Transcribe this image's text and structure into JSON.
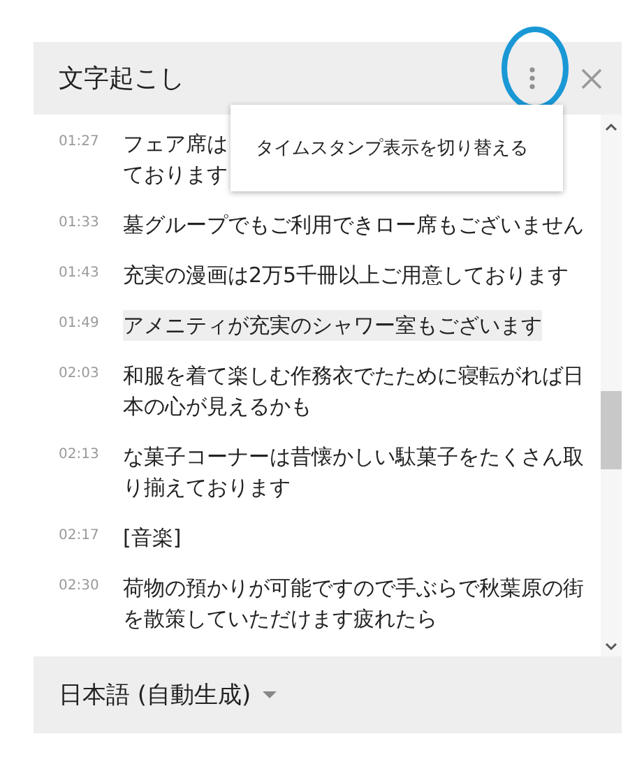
{
  "panel": {
    "title": "文字起こし"
  },
  "menu": {
    "items": [
      "タイムスタンプ表示を切り替える"
    ]
  },
  "transcript": [
    {
      "time": "01:27",
      "text": "フェア席は",
      "text_2": "ております",
      "current": false
    },
    {
      "time": "01:33",
      "text": "墓グループでもご利用できロー席もございません",
      "current": false
    },
    {
      "time": "01:43",
      "text": "充実の漫画は2万5千冊以上ご用意しております",
      "current": false
    },
    {
      "time": "01:49",
      "text": "アメニティが充実のシャワー室もございます",
      "current": true
    },
    {
      "time": "02:03",
      "text": "和服を着て楽しむ作務衣でたために寝転がれば日本の心が見えるかも",
      "current": false
    },
    {
      "time": "02:13",
      "text": "な菓子コーナーは昔懐かしい駄菓子をたくさん取り揃えております",
      "current": false
    },
    {
      "time": "02:17",
      "text": "[音楽]",
      "current": false
    },
    {
      "time": "02:30",
      "text": "荷物の預かりが可能ですので手ぶらで秋葉原の街を散策していただけます疲れたら",
      "current": false
    }
  ],
  "footer": {
    "language": "日本語 (自動生成)"
  }
}
